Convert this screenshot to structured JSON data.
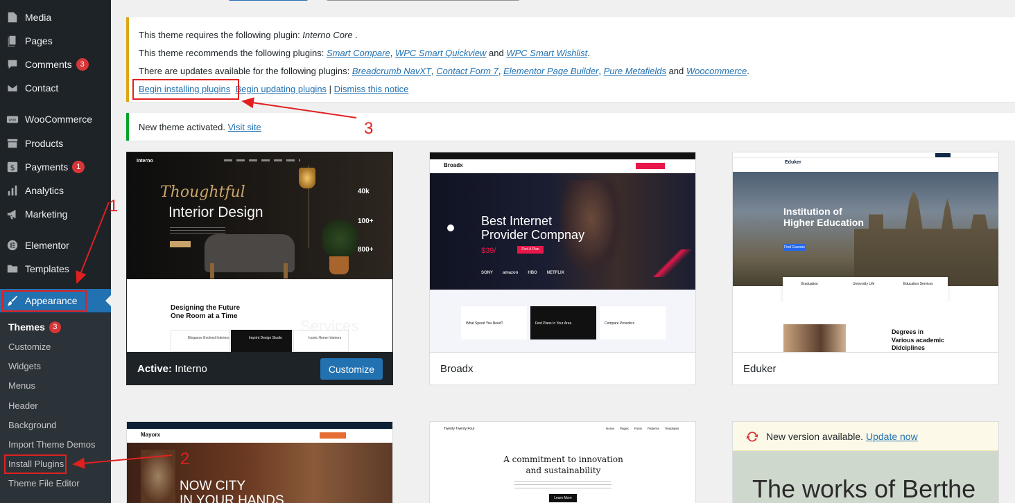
{
  "sidebar": {
    "items": [
      {
        "label": "Media",
        "icon": "media-icon"
      },
      {
        "label": "Pages",
        "icon": "pages-icon"
      },
      {
        "label": "Comments",
        "icon": "comments-icon",
        "badge": "3"
      },
      {
        "label": "Contact",
        "icon": "envelope-icon"
      },
      {
        "label": "WooCommerce",
        "icon": "woo-icon"
      },
      {
        "label": "Products",
        "icon": "archive-icon"
      },
      {
        "label": "Payments",
        "icon": "dollar-icon",
        "badge": "1"
      },
      {
        "label": "Analytics",
        "icon": "bar-chart-icon"
      },
      {
        "label": "Marketing",
        "icon": "megaphone-icon"
      },
      {
        "label": "Elementor",
        "icon": "elementor-icon"
      },
      {
        "label": "Templates",
        "icon": "folder-icon"
      },
      {
        "label": "Appearance",
        "icon": "paintbrush-icon"
      }
    ],
    "submenu": [
      {
        "label": "Themes",
        "badge": "3"
      },
      {
        "label": "Customize"
      },
      {
        "label": "Widgets"
      },
      {
        "label": "Menus"
      },
      {
        "label": "Header"
      },
      {
        "label": "Background"
      },
      {
        "label": "Import Theme Demos"
      },
      {
        "label": "Install Plugins"
      },
      {
        "label": "Theme File Editor"
      }
    ]
  },
  "notice_plugins": {
    "line1_prefix": "This theme requires the following plugin: ",
    "line1_plugin": "Interno Core",
    "line1_suffix": " .",
    "line2_prefix": "This theme recommends the following plugins: ",
    "line2_links": [
      "Smart Compare",
      "WPC Smart Quickview",
      "WPC Smart Wishlist"
    ],
    "line3_prefix": "There are updates available for the following plugins: ",
    "line3_links": [
      "Breadcrumb NavXT",
      "Contact Form 7",
      "Elementor Page Builder",
      "Pure Metafields",
      "Woocommerce"
    ],
    "sep_comma": ", ",
    "sep_and": " and ",
    "period": ".",
    "action_install": "Begin installing plugins",
    "action_update": "Begin updating plugins",
    "action_dismiss": "Dismiss this notice",
    "pipe": " | "
  },
  "notice_activated": {
    "text": "New theme activated. ",
    "link": "Visit site"
  },
  "themes": [
    {
      "name": "Interno",
      "active_prefix": "Active:",
      "customize_label": "Customize",
      "shot": {
        "logo": "Interno",
        "headline_script": "Thoughtful",
        "headline": "Interior Design",
        "stats": [
          "40k",
          "100+",
          "800+"
        ],
        "section_title_1": "Designing the Future",
        "section_title_2": "One Room at a Time",
        "services_bg": "Services",
        "cards": [
          "Elegance Evolved Interiors",
          "Imprint Design Studio",
          "Iconic Home Interiors"
        ]
      }
    },
    {
      "name": "Broadx",
      "shot": {
        "logo": "Broadx",
        "headline_1": "Best Internet",
        "headline_2": "Provider Compnay",
        "price": "$39/",
        "cta": "Find A Plan",
        "brands": [
          "SONY",
          "amazon",
          "HBO",
          "NETFLIX"
        ],
        "cards": [
          "What Speed You Need?",
          "Find Plans In Your Area",
          "Compare Providers"
        ]
      }
    },
    {
      "name": "Eduker",
      "shot": {
        "logo": "Eduker",
        "headline_1": "Institution of",
        "headline_2": "Higher Education",
        "cta": "Find Courses",
        "features": [
          "Graduation",
          "University Life",
          "Education Services"
        ],
        "bottom_1": "Degrees in",
        "bottom_2": "Various academic",
        "bottom_3": "Didciplines"
      }
    },
    {
      "name": "Mayorx",
      "shot": {
        "logo": "Mayorx",
        "headline_1": "NOW CITY",
        "headline_2": "IN YOUR HANDS"
      }
    },
    {
      "name": "Twenty Twenty Four",
      "shot": {
        "logo": "Twenty Twenty Four",
        "nav": [
          "Home",
          "Pages",
          "Posts",
          "Patterns",
          "Templates"
        ],
        "headline_1": "A commitment to innovation",
        "headline_2": "and sustainability",
        "cta": "Learn More"
      }
    },
    {
      "name": "Berthe",
      "update_text": "New version available. ",
      "update_link": "Update now",
      "shot": {
        "headline": "The works of Berthe"
      }
    }
  ],
  "annotations": [
    "1",
    "2",
    "3"
  ],
  "colors": {
    "sidebar_bg": "#1d2327",
    "accent": "#2271b1",
    "annotation": "#e02020",
    "warning_border": "#dba617",
    "success_border": "#00a32a"
  }
}
